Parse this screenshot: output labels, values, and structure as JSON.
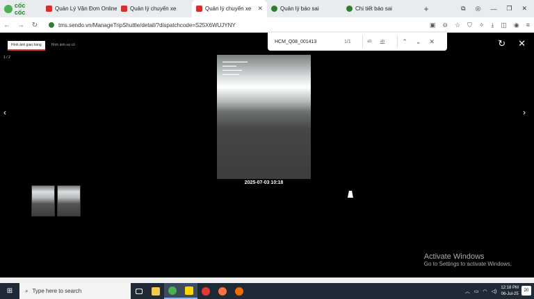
{
  "browser": {
    "brand": "cốc cốc",
    "tabs": [
      {
        "label": "Quản Lý Vận Đơn Online ("
      },
      {
        "label": "Quản lý chuyến xe"
      },
      {
        "label": "Quản lý chuyến xe"
      },
      {
        "label": "Quản lý báo sai"
      },
      {
        "label": "Chi tiết báo sai"
      }
    ],
    "url": "tms.sendo.vn/ManageTripShuttle/detail/?dispatchcode=S25X6WUJYNY"
  },
  "find": {
    "query": "HCM_Q08_001413",
    "count": "1/1",
    "opt_case": "ab",
    "opt_word": "ab"
  },
  "viewer": {
    "tabs": [
      {
        "label": "Hình ảnh giao hàng"
      },
      {
        "label": "Hình ảnh sự cố"
      }
    ],
    "counter": "1 / 2",
    "caption": "2025-07-03 10:18"
  },
  "watermark": {
    "line1": "Activate Windows",
    "line2": "Go to Settings to activate Windows."
  },
  "taskbar": {
    "search_placeholder": "Type here to search",
    "time": "12:18 PM",
    "date": "06-Jul-25",
    "notifications": "20"
  }
}
